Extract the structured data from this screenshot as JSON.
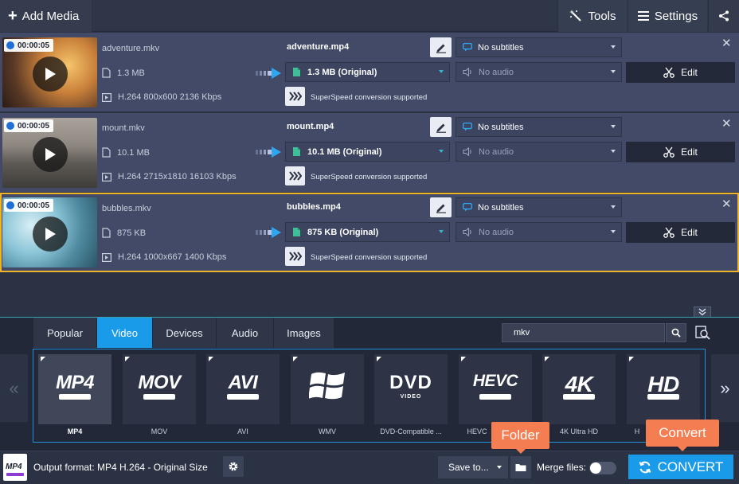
{
  "toolbar": {
    "add_media_label": "Add Media",
    "tools_label": "Tools",
    "settings_label": "Settings"
  },
  "files": [
    {
      "duration": "00:00:05",
      "source_name": "adventure.mkv",
      "source_size": "1.3 MB",
      "source_codec": "H.264 800x600 2136 Kbps",
      "output_name": "adventure.mp4",
      "output_size": "1.3 MB (Original)",
      "subtitles": "No subtitles",
      "audio": "No audio",
      "superspeed": "SuperSpeed conversion supported",
      "edit_label": "Edit"
    },
    {
      "duration": "00:00:05",
      "source_name": "mount.mkv",
      "source_size": "10.1 MB",
      "source_codec": "H.264 2715x1810 16103 Kbps",
      "output_name": "mount.mp4",
      "output_size": "10.1 MB (Original)",
      "subtitles": "No subtitles",
      "audio": "No audio",
      "superspeed": "SuperSpeed conversion supported",
      "edit_label": "Edit"
    },
    {
      "duration": "00:00:05",
      "source_name": "bubbles.mkv",
      "source_size": "875 KB",
      "source_codec": "H.264 1000x667 1400 Kbps",
      "output_name": "bubbles.mp4",
      "output_size": "875 KB (Original)",
      "subtitles": "No subtitles",
      "audio": "No audio",
      "superspeed": "SuperSpeed conversion supported",
      "edit_label": "Edit"
    }
  ],
  "format_tabs": [
    "Popular",
    "Video",
    "Devices",
    "Audio",
    "Images"
  ],
  "active_tab": "Video",
  "search": {
    "value": "mkv"
  },
  "formats": [
    {
      "logo": "MP4",
      "label": "MP4"
    },
    {
      "logo": "MOV",
      "label": "MOV"
    },
    {
      "logo": "AVI",
      "label": "AVI"
    },
    {
      "logo": "",
      "label": "WMV"
    },
    {
      "logo": "DVD",
      "label": "DVD-Compatible ..."
    },
    {
      "logo": "HEVC",
      "label": "HEVC"
    },
    {
      "logo": "4K",
      "label": "4K Ultra HD"
    },
    {
      "logo": "HD",
      "label": "H"
    }
  ],
  "bottom": {
    "format_icon_text": "MP4",
    "output_format_label": "Output format: MP4 H.264 - Original Size",
    "save_to_label": "Save to...",
    "merge_label": "Merge files:",
    "convert_label": "CONVERT"
  },
  "callouts": {
    "folder": "Folder",
    "convert": "Convert"
  },
  "colors": {
    "accent": "#1a9bea",
    "callout": "#f47d52",
    "selected_border": "#f0b429",
    "row_bg": "#424a67"
  }
}
